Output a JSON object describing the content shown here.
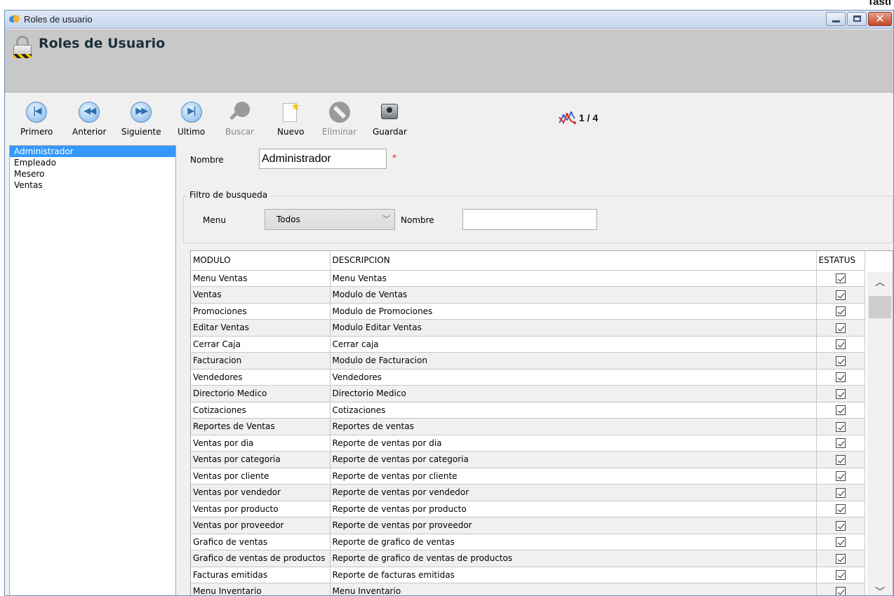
{
  "corner_text": "Tasti",
  "window": {
    "title": "Roles de usuario"
  },
  "header": {
    "title": "Roles de Usuario"
  },
  "toolbar": {
    "primero": "Primero",
    "anterior": "Anterior",
    "siguiente": "Siguiente",
    "ultimo": "Ultimo",
    "buscar": "Buscar",
    "nuevo": "Nuevo",
    "eliminar": "Eliminar",
    "guardar": "Guardar",
    "pager": "1 / 4"
  },
  "roles": [
    "Administrador",
    "Empleado",
    "Mesero",
    "Ventas"
  ],
  "form": {
    "nombre_label": "Nombre",
    "nombre_value": "Administrador",
    "required_mark": "*",
    "filter_legend": "Filtro de busqueda",
    "menu_label": "Menu",
    "menu_selected": "Todos",
    "filter_nombre_label": "Nombre"
  },
  "table": {
    "headers": [
      "MODULO",
      "DESCRIPCION",
      "ESTATUS"
    ],
    "rows": [
      [
        "Menu Ventas",
        "Menu Ventas"
      ],
      [
        "Ventas",
        "Modulo de Ventas"
      ],
      [
        "Promociones",
        "Modulo de Promociones"
      ],
      [
        "Editar Ventas",
        "Modulo Editar Ventas"
      ],
      [
        "Cerrar Caja",
        "Cerrar caja"
      ],
      [
        "Facturacion",
        "Modulo de Facturacion"
      ],
      [
        "Vendedores",
        "Vendedores"
      ],
      [
        "Directorio Medico",
        "Directorio Medico"
      ],
      [
        "Cotizaciones",
        "Cotizaciones"
      ],
      [
        "Reportes de Ventas",
        "Reportes de ventas"
      ],
      [
        "Ventas por dia",
        "Reporte de ventas por dia"
      ],
      [
        "Ventas por categoria",
        "Reporte de ventas por categoria"
      ],
      [
        "Ventas por cliente",
        "Reporte de ventas por cliente"
      ],
      [
        "Ventas por vendedor",
        "Reporte de ventas por vendedor"
      ],
      [
        "Ventas por producto",
        "Reporte de ventas por producto"
      ],
      [
        "Ventas por proveedor",
        "Reporte de ventas por proveedor"
      ],
      [
        "Grafico de ventas",
        "Reporte de grafico de ventas"
      ],
      [
        "Grafico de ventas de productos",
        "Reporte de grafico de ventas de productos"
      ],
      [
        "Facturas emitidas",
        "Reporte de facturas emitidas"
      ],
      [
        "Menu Inventario",
        "Menu Inventario"
      ]
    ],
    "status_checked": true
  }
}
